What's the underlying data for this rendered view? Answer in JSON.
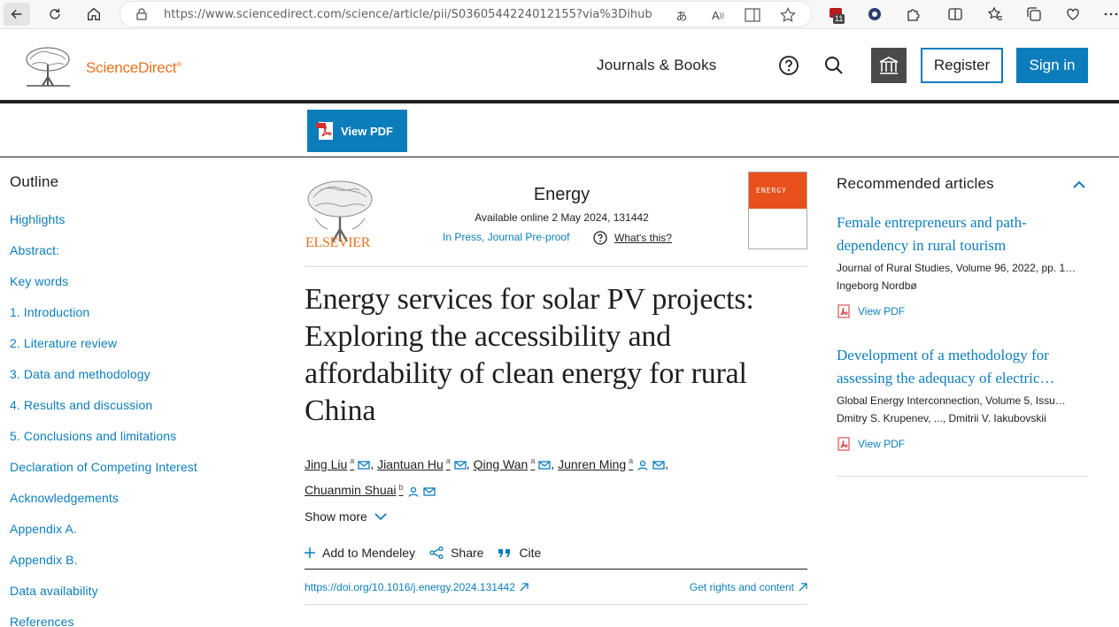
{
  "browser": {
    "url": "https://www.sciencedirect.com/science/article/pii/S0360544224012155?via%3Dihub",
    "ext_badge": "11"
  },
  "header": {
    "logo_text": "ScienceDirect",
    "logo_mark": "®",
    "journals_link": "Journals & Books",
    "register_label": "Register",
    "signin_label": "Sign in"
  },
  "toolbar": {
    "view_pdf_label": "View PDF"
  },
  "outline": {
    "title": "Outline",
    "items": [
      "Highlights",
      "Abstract:",
      "Key words",
      "1. Introduction",
      "2. Literature review",
      "3. Data and methodology",
      "4. Results and discussion",
      "5. Conclusions and limitations",
      "Declaration of Competing Interest",
      "Acknowledgements",
      "Appendix A.",
      "Appendix B.",
      "Data availability",
      "References"
    ]
  },
  "article": {
    "publisher": "ELSEVIER",
    "journal": "Energy",
    "available": "Available online 2 May 2024, 131442",
    "status": "In Press, Journal Pre-proof",
    "whats_this": "What's this?",
    "cover_text": "ENERGY",
    "title": "Energy services for solar PV projects: Exploring the accessibility and affordability of clean energy for rural China",
    "authors": [
      {
        "name": "Jing Liu",
        "aff": "a"
      },
      {
        "name": "Jiantuan Hu",
        "aff": "a"
      },
      {
        "name": "Qing Wan",
        "aff": "a"
      },
      {
        "name": "Junren Ming",
        "aff": "a"
      },
      {
        "name": "Chuanmin Shuai",
        "aff": "b"
      }
    ],
    "show_more": "Show more",
    "actions": {
      "mendeley": "Add to Mendeley",
      "share": "Share",
      "cite": "Cite"
    },
    "doi": "https://doi.org/10.1016/j.energy.2024.131442",
    "rights": "Get rights and content"
  },
  "recommended": {
    "title": "Recommended articles",
    "items": [
      {
        "title": "Female entrepreneurs and path-dependency in rural tourism",
        "source": "Journal of Rural Studies, Volume 96, 2022, pp. 1…",
        "authors": "Ingeborg Nordbø",
        "pdf": "View PDF"
      },
      {
        "title": "Development of a methodology for assessing the adequacy of electric…",
        "source": "Global Energy Interconnection, Volume 5, Issu…",
        "authors": "Dmitry S. Krupenev, ..., Dmitrii V. Iakubovskii",
        "pdf": "View PDF"
      }
    ]
  },
  "colors": {
    "link_blue": "#0c7dbb",
    "elsevier_orange": "#e9711c"
  }
}
